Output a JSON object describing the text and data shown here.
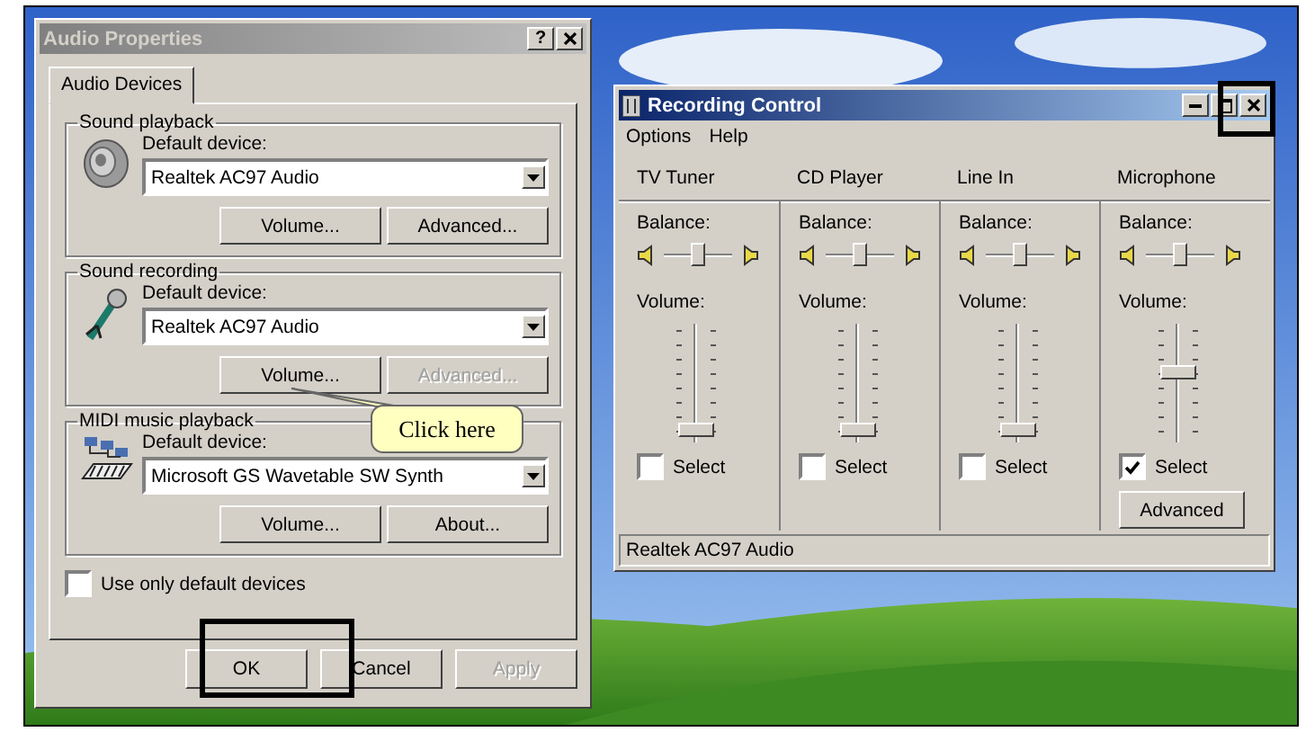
{
  "audio_properties": {
    "title": "Audio Properties",
    "help_button": "?",
    "tabs": [
      {
        "label": "Audio Devices",
        "selected": true
      }
    ],
    "groups": [
      {
        "title": "Sound playback",
        "kind": "speaker",
        "device_label": "Default device:",
        "device": "Realtek AC97 Audio",
        "buttons": [
          {
            "label": "Volume...",
            "disabled": false
          },
          {
            "label": "Advanced...",
            "disabled": false
          }
        ]
      },
      {
        "title": "Sound recording",
        "kind": "microphone",
        "device_label": "Default device:",
        "device": "Realtek AC97 Audio",
        "buttons": [
          {
            "label": "Volume...",
            "disabled": false
          },
          {
            "label": "Advanced...",
            "disabled": true
          }
        ]
      },
      {
        "title": "MIDI music playback",
        "kind": "midi",
        "device_label": "Default device:",
        "device": "Microsoft GS Wavetable SW Synth",
        "buttons": [
          {
            "label": "Volume...",
            "disabled": false
          },
          {
            "label": "About...",
            "disabled": false
          }
        ]
      }
    ],
    "default_only": {
      "label": "Use only default devices",
      "checked": false
    },
    "buttons": [
      {
        "label": "OK",
        "disabled": false
      },
      {
        "label": "Cancel",
        "disabled": false
      },
      {
        "label": "Apply",
        "disabled": true
      }
    ]
  },
  "recording_control": {
    "title": "Recording Control",
    "menu": [
      "Options",
      "Help"
    ],
    "channels": [
      {
        "name": "TV Tuner",
        "balance_label": "Balance:",
        "balance": {
          "level": 0.5
        },
        "volume_label": "Volume:",
        "volume": {
          "level": 0.05
        },
        "select": {
          "label": "Select",
          "checked": false
        }
      },
      {
        "name": "CD Player",
        "balance_label": "Balance:",
        "balance": {
          "level": 0.5
        },
        "volume_label": "Volume:",
        "volume": {
          "level": 0.05
        },
        "select": {
          "label": "Select",
          "checked": false
        }
      },
      {
        "name": "Line In",
        "balance_label": "Balance:",
        "balance": {
          "level": 0.5
        },
        "volume_label": "Volume:",
        "volume": {
          "level": 0.05
        },
        "select": {
          "label": "Select",
          "checked": false
        }
      },
      {
        "name": "Microphone",
        "balance_label": "Balance:",
        "balance": {
          "level": 0.5
        },
        "volume_label": "Volume:",
        "volume": {
          "level": 0.6
        },
        "select": {
          "label": "Select",
          "checked": true
        },
        "advanced_button": "Advanced"
      }
    ],
    "status": "Realtek AC97 Audio"
  },
  "callout": {
    "text": "Click here"
  }
}
